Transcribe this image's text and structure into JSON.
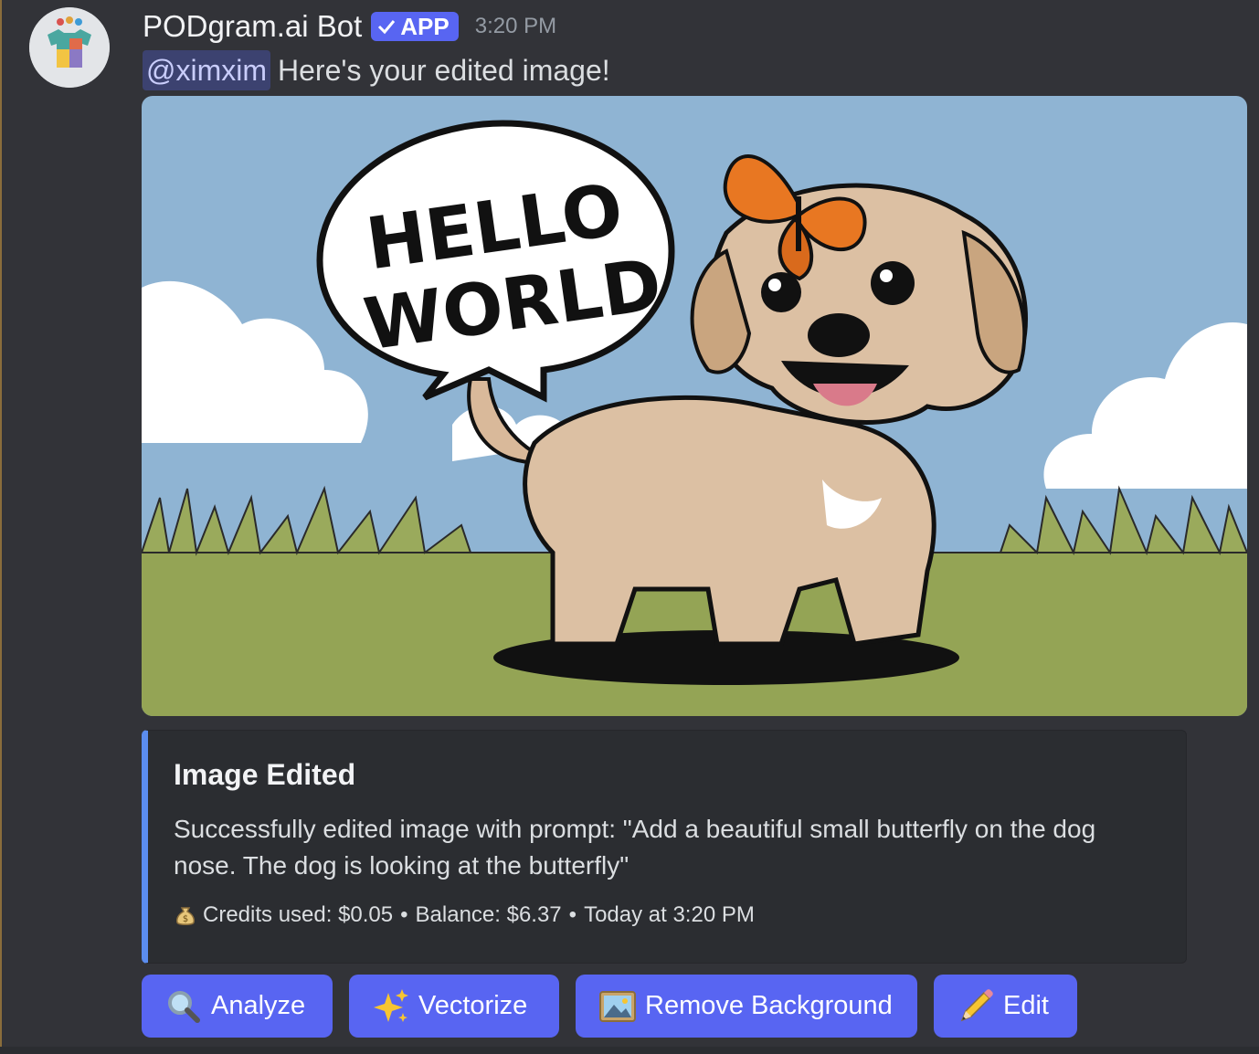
{
  "message": {
    "author": "PODgram.ai Bot",
    "badge": "APP",
    "timestamp": "3:20 PM",
    "mention": "@ximxim",
    "text": "Here's your edited image!"
  },
  "image": {
    "speech_bubble_line1": "HELLO",
    "speech_bubble_line2": "WORLD"
  },
  "embed": {
    "title": "Image Edited",
    "description": "Successfully edited image with prompt: \"Add a beautiful small butterfly on the dog nose. The dog is looking at the butterfly\"",
    "footer_credits": "Credits used: $0.05",
    "footer_balance": "Balance: $6.37",
    "footer_time": "Today at 3:20 PM",
    "footer_icon": "money-bag-icon",
    "accent_color": "#5b8def"
  },
  "buttons": [
    {
      "label": "Analyze",
      "icon": "magnifier-icon"
    },
    {
      "label": "Vectorize",
      "icon": "sparkles-icon"
    },
    {
      "label": "Remove Background",
      "icon": "picture-icon"
    },
    {
      "label": "Edit",
      "icon": "pencil-icon"
    }
  ],
  "colors": {
    "button": "#5865f2",
    "background": "#323338",
    "embed_bg": "#2b2d31"
  }
}
